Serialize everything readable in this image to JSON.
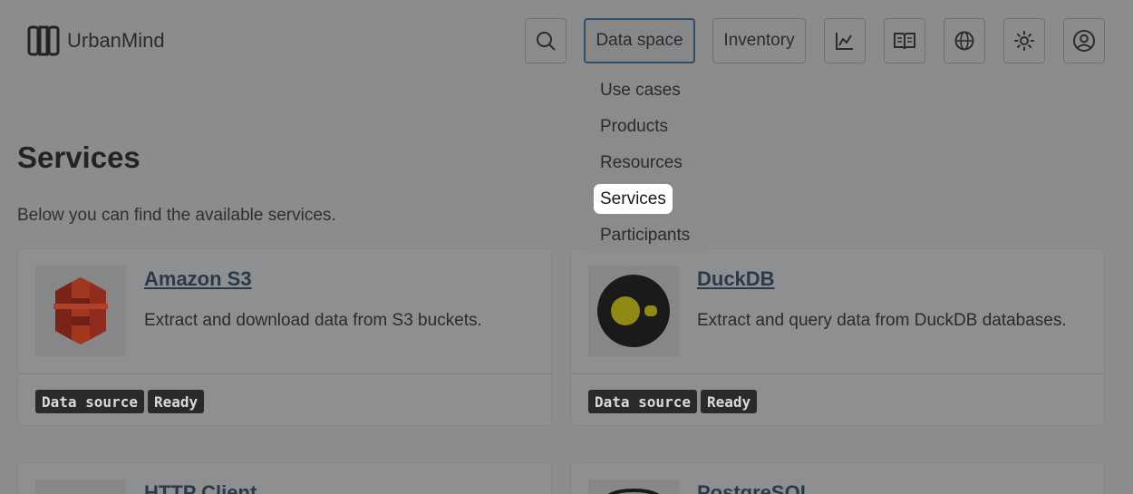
{
  "brand": {
    "name": "UrbanMind",
    "icon": "urbanmind-logo-icon"
  },
  "header": {
    "search_icon": "search-icon",
    "nav": [
      {
        "label": "Data space",
        "active": true
      },
      {
        "label": "Inventory",
        "active": false
      }
    ],
    "icons": [
      "chart-icon",
      "book-icon",
      "globe-icon",
      "theme-icon",
      "account-icon"
    ]
  },
  "dropdown": {
    "items": [
      {
        "label": "Use cases"
      },
      {
        "label": "Products"
      },
      {
        "label": "Resources"
      },
      {
        "label": "Services",
        "highlighted": true
      },
      {
        "label": "Participants"
      }
    ]
  },
  "page": {
    "title": "Services",
    "description": "Below you can find the available services."
  },
  "cards": [
    {
      "title": "Amazon S3",
      "description": "Extract and download data from S3 buckets.",
      "logo": "amazon-s3-logo",
      "tags": [
        "Data source",
        "Ready"
      ]
    },
    {
      "title": "DuckDB",
      "description": "Extract and query data from DuckDB databases.",
      "logo": "duckdb-logo",
      "tags": [
        "Data source",
        "Ready"
      ]
    },
    {
      "title": "HTTP Client",
      "logo": "http-client-logo"
    },
    {
      "title": "PostgreSQL",
      "logo": "postgresql-logo"
    }
  ],
  "colors": {
    "overlay": "#8c8c8d",
    "tag_bg": "#2a2a2c",
    "highlight": "#ffffff",
    "active_border": "#2f4f6a"
  }
}
